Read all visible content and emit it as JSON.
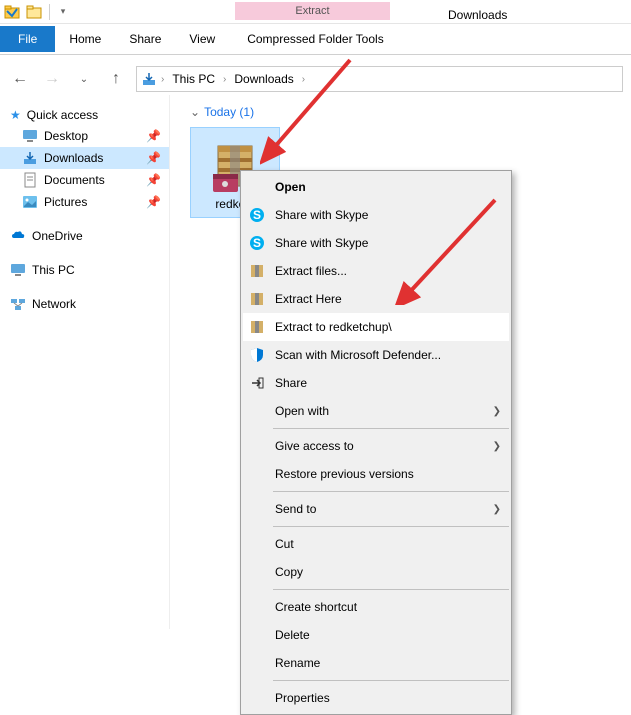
{
  "qat": {
    "dropdown": "▾"
  },
  "ribbon": {
    "file": "File",
    "home": "Home",
    "share": "Share",
    "view": "View",
    "context_header": "Extract",
    "context_tab": "Compressed Folder Tools",
    "downloads_title": "Downloads"
  },
  "nav": {
    "back": "←",
    "forward": "→",
    "recent": "⌄",
    "up": "↑"
  },
  "breadcrumb": {
    "root": "This PC",
    "folder": "Downloads"
  },
  "sidebar": {
    "quick": "Quick access",
    "items": [
      {
        "label": "Desktop"
      },
      {
        "label": "Downloads"
      },
      {
        "label": "Documents"
      },
      {
        "label": "Pictures"
      }
    ],
    "onedrive": "OneDrive",
    "thispc": "This PC",
    "network": "Network"
  },
  "content": {
    "group": "Today (1)",
    "file_label": "redketc"
  },
  "context_menu": {
    "open": "Open",
    "skype1": "Share with Skype",
    "skype2": "Share with Skype",
    "extract_files": "Extract files...",
    "extract_here": "Extract Here",
    "extract_to": "Extract to redketchup\\",
    "defender": "Scan with Microsoft Defender...",
    "share": "Share",
    "open_with": "Open with",
    "give_access": "Give access to",
    "restore": "Restore previous versions",
    "send_to": "Send to",
    "cut": "Cut",
    "copy": "Copy",
    "shortcut": "Create shortcut",
    "delete": "Delete",
    "rename": "Rename",
    "properties": "Properties"
  }
}
